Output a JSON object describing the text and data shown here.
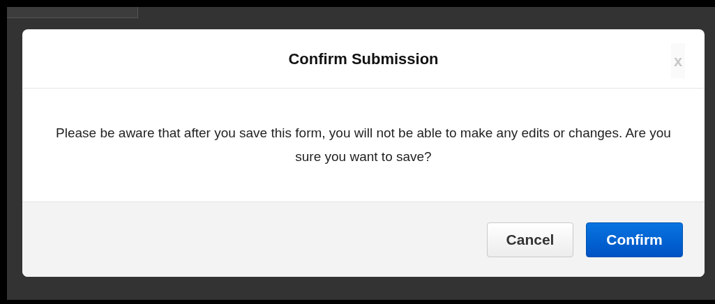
{
  "dialog": {
    "title": "Confirm Submission",
    "close": "x",
    "message": "Please be aware that after you save this form, you will not be able to make any edits or changes. Are you sure you want to save?",
    "buttons": [
      {
        "label": "Cancel",
        "kind": "secondary"
      },
      {
        "label": "Confirm",
        "kind": "primary"
      }
    ]
  }
}
